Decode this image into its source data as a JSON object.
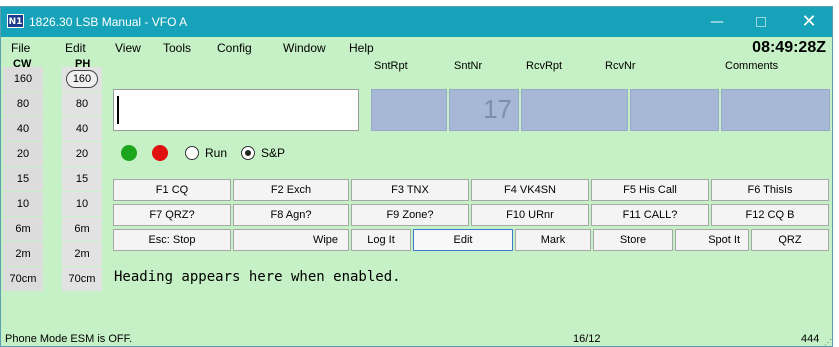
{
  "window": {
    "title": "1826.30 LSB Manual - VFO A",
    "icon_text": "N1",
    "controls": {
      "minimize": "—",
      "maximize": "",
      "close": "✕"
    }
  },
  "menu": [
    "File",
    "Edit",
    "View",
    "Tools",
    "Config",
    "Window",
    "Help"
  ],
  "clock": "08:49:28Z",
  "band_columns": {
    "cw_header": "CW",
    "ph_header": "PH"
  },
  "bands": [
    "160",
    "80",
    "40",
    "20",
    "15",
    "10",
    "6m",
    "2m",
    "70cm"
  ],
  "selected_band": {
    "column": "PH",
    "band": "160"
  },
  "entry": {
    "callsign": "",
    "field_headers": [
      "SntRpt",
      "SntNr",
      "RcvRpt",
      "RcvNr",
      "Comments"
    ],
    "field_values": [
      "",
      "17",
      "",
      "",
      ""
    ]
  },
  "indicators": {
    "led_left": "green",
    "led_right": "red"
  },
  "mode": {
    "options": [
      "Run",
      "S&P"
    ],
    "selected": "S&P"
  },
  "fkeys_row1": [
    "F1 CQ",
    "F2 Exch",
    "F3 TNX",
    "F4 VK4SN",
    "F5 His Call",
    "F6 ThisIs"
  ],
  "fkeys_row2": [
    "F7 QRZ?",
    "F8 Agn?",
    "F9 Zone?",
    "F10 URnr",
    "F11 CALL?",
    "F12 CQ B"
  ],
  "action_buttons": [
    "Esc: Stop",
    "Wipe",
    "Log It",
    "Edit",
    "Mark",
    "Store",
    "Spot It",
    "QRZ"
  ],
  "focused_button": "Edit",
  "heading_text": "Heading appears here when enabled.",
  "status": {
    "left": "Phone Mode ESM is OFF.",
    "middle": "16/12",
    "right": "444"
  },
  "colors": {
    "titlebar": "#16a2b8",
    "window_bg": "#c6f0c6",
    "exchange_field": "#a7b7d6",
    "led_green": "#1aa51a",
    "led_red": "#e01010"
  }
}
